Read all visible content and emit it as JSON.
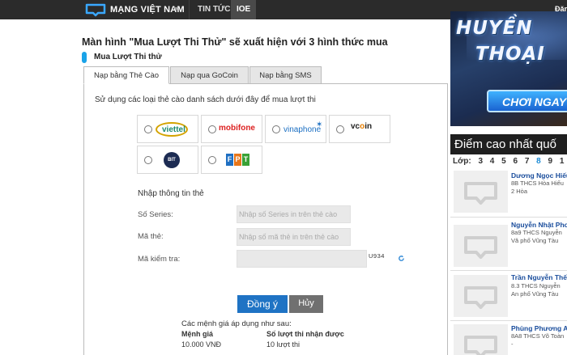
{
  "header": {
    "brand": "MẠNG VIỆT NAM",
    "nav_tintuc": "TIN TỨC",
    "nav_ioe": "IOE",
    "login": "Đăn"
  },
  "main": {
    "title": "Màn hình \"Mua Lượt Thi Thử\" sẽ xuất hiện với 3 hình thức mua",
    "section_title": "Mua Lượt Thi thử",
    "tabs": [
      {
        "label": "Nạp bằng Thẻ Cào"
      },
      {
        "label": "Nạp qua GoCoin"
      },
      {
        "label": "Nạp bằng SMS"
      }
    ],
    "intro": "Sử dụng các loại thẻ cào danh sách dưới đây để mua lượt thi",
    "cards": {
      "viettel": "viettel",
      "mobifone": "mobifone",
      "vinaphone": "vinaphone",
      "vcoin_v": "vc",
      "vcoin_o": "o",
      "vcoin_n": "in",
      "bit": "BIT",
      "fpt": [
        "F",
        "P",
        "T"
      ]
    },
    "form": {
      "heading": "Nhập thông tin thẻ",
      "series_label": "Số Series:",
      "series_placeholder": "Nhập số Series in trên thẻ cào",
      "code_label": "Mã thẻ:",
      "code_placeholder": "Nhập số mã thẻ in trên thẻ cào",
      "captcha_label": "Mã kiểm tra:",
      "captcha_value": "",
      "captcha_image": "U934"
    },
    "buttons": {
      "ok": "Đồng ý",
      "cancel": "Hủy"
    },
    "note": "Các mệnh giá áp dụng như sau:",
    "table": {
      "col1": "Mệnh giá",
      "col2": "Số lượt thi nhận được",
      "row1_col1": "10.000 VNĐ",
      "row1_col2": "10 lượt thi"
    }
  },
  "sidebar": {
    "banner_line1": "HUYỀN",
    "banner_line2": "THOẠI",
    "banner_button": "CHƠI NGAY",
    "score_title": "Điểm cao nhất quố",
    "grade_label": "Lớp:",
    "grades": [
      "3",
      "4",
      "5",
      "6",
      "7",
      "8",
      "9",
      "1"
    ],
    "entries": [
      {
        "name": "Dương Ngọc Hiếu",
        "info": "8B THCS Hòa Hiếu 2 Hòa"
      },
      {
        "name": "Nguyễn Nhật Phon",
        "info": "8a9 THCS Nguyễn Vă phố Vũng Tàu"
      },
      {
        "name": "Trần Nguyễn Thế H",
        "info": "8.3 THCS Nguyễn An phố Vũng Tàu"
      },
      {
        "name": "Phùng Phương An",
        "info": "8A8 THCS Võ Toàn -"
      }
    ]
  },
  "colors": {
    "accent": "#1f73c4",
    "topbar": "#2b2b2b",
    "section_bar": "#1aa3e8"
  }
}
